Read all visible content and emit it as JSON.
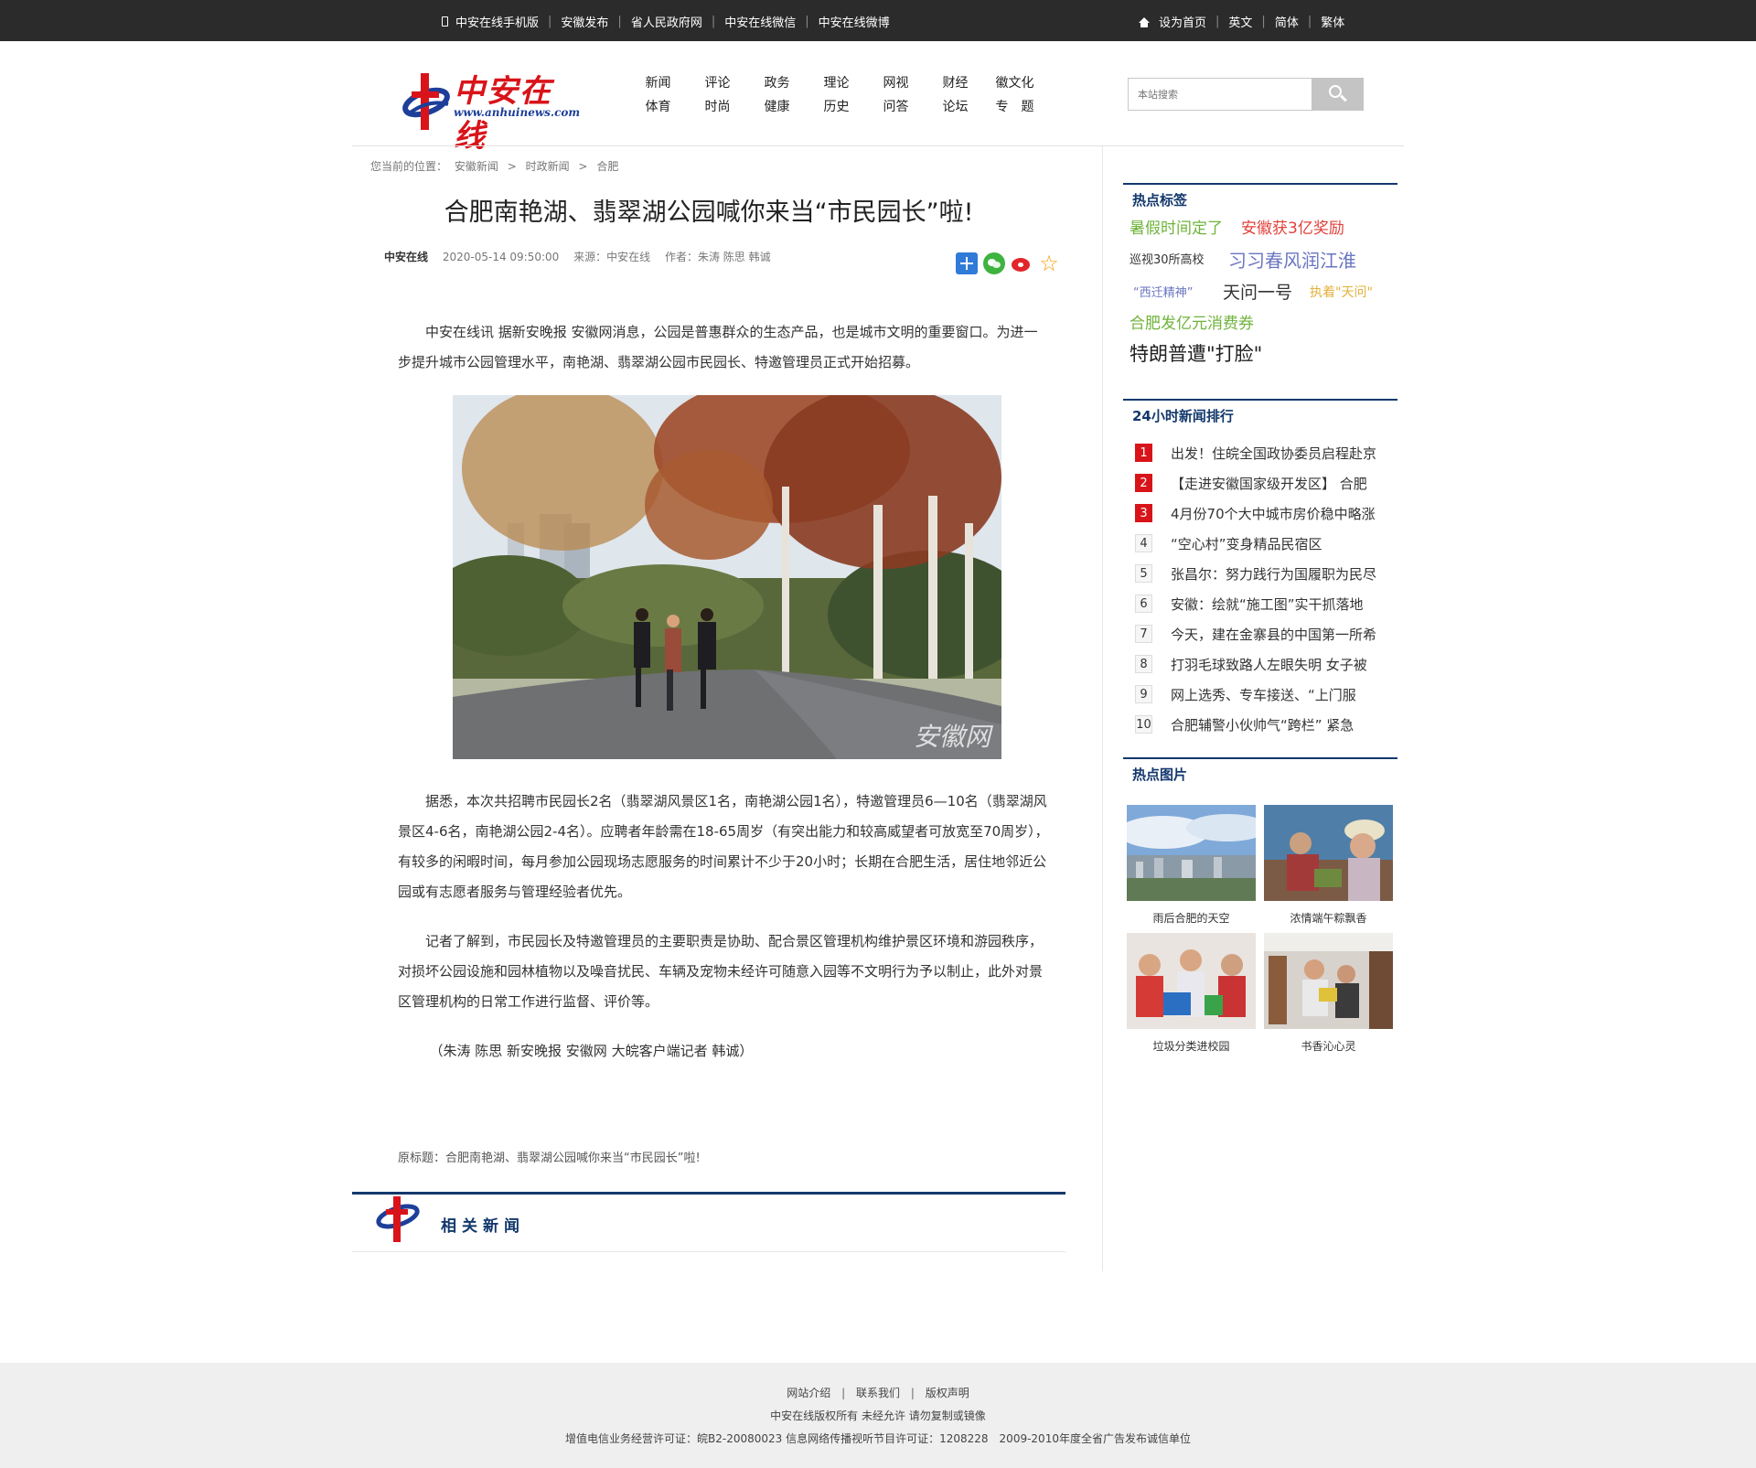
{
  "topbar": {
    "left_links": [
      "中安在线手机版",
      "安徽发布",
      "省人民政府网",
      "中安在线微信",
      "中安在线微博"
    ],
    "right_links": [
      "设为首页",
      "英文",
      "简体",
      "繁体"
    ],
    "left_icon": "phone-icon",
    "right_icon": "home-icon"
  },
  "header": {
    "logo_text": "中安在线",
    "logo_url": "www.anhuinews.com",
    "nav": [
      {
        "top": "新闻",
        "bottom": "体育"
      },
      {
        "top": "评论",
        "bottom": "时尚"
      },
      {
        "top": "政务",
        "bottom": "健康"
      },
      {
        "top": "理论",
        "bottom": "历史"
      },
      {
        "top": "网视",
        "bottom": "问答"
      },
      {
        "top": "财经",
        "bottom": "论坛"
      },
      {
        "top": "徽文化",
        "bottom": "专　题"
      }
    ],
    "search_placeholder": "本站搜索",
    "search_icon": "search-icon"
  },
  "breadcrumb": {
    "label": "您当前的位置：",
    "items": [
      "安徽新闻",
      "时政新闻",
      "合肥"
    ]
  },
  "article": {
    "title": "合肥南艳湖、翡翠湖公园喊你来当“市民园长”啦!",
    "site": "中安在线",
    "datetime": "2020-05-14 09:50:00",
    "source": "来源：中安在线",
    "author": "作者：朱涛 陈思 韩诚",
    "paragraphs": [
      "中安在线讯 据新安晚报 安徽网消息，公园是普惠群众的生态产品，也是城市文明的重要窗口。为进一步提升城市公园管理水平，南艳湖、翡翠湖公园市民园长、特邀管理员正式开始招募。",
      "据悉，本次共招聘市民园长2名（翡翠湖风景区1名，南艳湖公园1名），特邀管理员6—10名（翡翠湖风景区4-6名，南艳湖公园2-4名）。应聘者年龄需在18-65周岁（有突出能力和较高威望者可放宽至70周岁），有较多的闲暇时间，每月参加公园现场志愿服务的时间累计不少于20小时；长期在合肥生活，居住地邻近公园或有志愿者服务与管理经验者优先。",
      "记者了解到，市民园长及特邀管理员的主要职责是协助、配合景区管理机构维护景区环境和游园秩序，对损坏公园设施和园林植物以及噪音扰民、车辆及宠物未经许可随意入园等不文明行为予以制止，此外对景区管理机构的日常工作进行监督、评价等。",
      "（朱涛 陈思 新安晚报 安徽网 大皖客户端记者 韩诚）"
    ],
    "photo_watermark": "安徽网",
    "original_title": "原标题：合肥南艳湖、翡翠湖公园喊你来当“市民园长”啦!",
    "related_title": "相关新闻"
  },
  "sidebar": {
    "hot_tags_title": "热点标签",
    "hot_tags": [
      {
        "text": "暑假时间定了",
        "color": "#6fb33b"
      },
      {
        "text": "安徽获3亿奖励",
        "color": "#e0413b"
      },
      {
        "text": "巡视30所高校",
        "color": "#333333"
      },
      {
        "text": "习习春风润江淮",
        "color": "#6a76c2"
      },
      {
        "text": "“西迁精神”",
        "color": "#6a76c2"
      },
      {
        "text": "天问一号",
        "color": "#333333"
      },
      {
        "text": "执着\"天问\"",
        "color": "#e3b03a"
      },
      {
        "text": "合肥发亿元消费券",
        "color": "#6fb33b"
      },
      {
        "text": "特朗普遭\"打脸\"",
        "color": "#222222"
      }
    ],
    "rank_title": "24小时新闻排行",
    "rank": [
      {
        "num": "1",
        "text": "出发！住皖全国政协委员启程赴京"
      },
      {
        "num": "2",
        "text": "【走进安徽国家级开发区】 合肥"
      },
      {
        "num": "3",
        "text": "4月份70个大中城市房价稳中略涨"
      },
      {
        "num": "4",
        "text": "“空心村”变身精品民宿区"
      },
      {
        "num": "5",
        "text": "张昌尔：努力践行为国履职为民尽"
      },
      {
        "num": "6",
        "text": "安徽：绘就“施工图”实干抓落地"
      },
      {
        "num": "7",
        "text": "今天，建在金寨县的中国第一所希"
      },
      {
        "num": "8",
        "text": "打羽毛球致路人左眼失明 女子被"
      },
      {
        "num": "9",
        "text": "网上选秀、专车接送、“上门服"
      },
      {
        "num": "10",
        "text": "合肥辅警小伙帅气“跨栏” 紧急"
      }
    ],
    "pics_title": "热点图片",
    "pics": [
      {
        "caption": "雨后合肥的天空"
      },
      {
        "caption": "浓情端午粽飘香"
      },
      {
        "caption": "垃圾分类进校园"
      },
      {
        "caption": "书香沁心灵"
      }
    ],
    "accent_color": "#13386c"
  },
  "footer": {
    "links": [
      "网站介绍",
      "联系我们",
      "版权声明"
    ],
    "copyright": "中安在线版权所有 未经允许 请勿复制或镜像",
    "license": "增值电信业务经营许可证：皖B2-20080023 信息网络传播视听节目许可证：1208228　2009-2010年度全省广告发布诚信单位"
  }
}
